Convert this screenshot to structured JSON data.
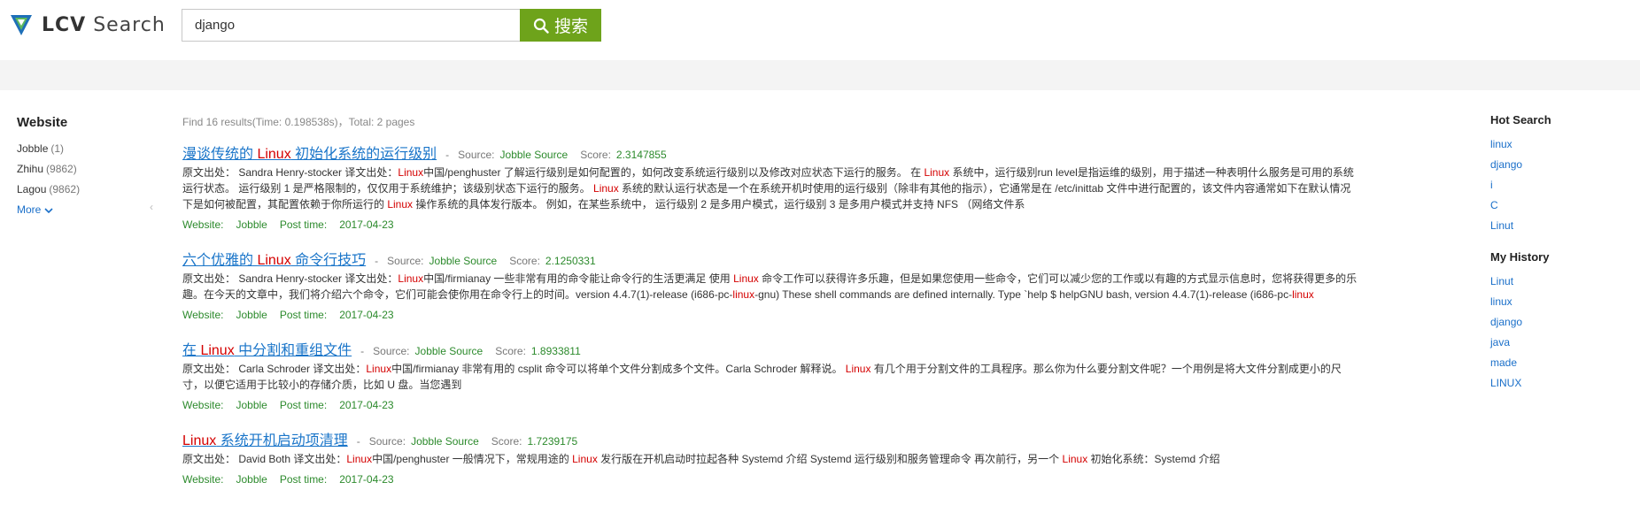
{
  "logo": {
    "brand": "LCV",
    "suffix": "Search"
  },
  "search": {
    "query": "django",
    "button_label": "搜索"
  },
  "left_nav": {
    "title": "Website",
    "items": [
      {
        "label": "Jobble",
        "count": "(1)"
      },
      {
        "label": "Zhihu",
        "count": "(9862)"
      },
      {
        "label": "Lagou",
        "count": "(9862)"
      }
    ],
    "more_label": "More"
  },
  "summary": "Find 16 results(Time: 0.198538s)，Total: 2 pages",
  "labels": {
    "source": "Source:",
    "score": "Score:",
    "website": "Website:",
    "post_time": "Post time:"
  },
  "results": [
    {
      "title_pre": "漫谈传统的 ",
      "title_hl": "Linux",
      "title_post": " 初始化系统的运行级别",
      "source": "Jobble Source",
      "score": "2.3147855",
      "body": [
        {
          "t": "原文出处： Sandra Henry-stocker 译文出处："
        },
        {
          "t": "Linux",
          "hl": true
        },
        {
          "t": "中国/penghuster 了解运行级别是如何配置的，如何改变系统运行级别以及修改对应状态下运行的服务。 在 "
        },
        {
          "t": "Linux",
          "hl": true
        },
        {
          "t": " 系统中，运行级别run level是指运维的级别，用于描述一种表明什么服务是可用的系统运行状态。 运行级别 1 是严格限制的，仅仅用于系统维护；该级别状态下运行的服务。 "
        },
        {
          "t": "Linux",
          "hl": true
        },
        {
          "t": " 系统的默认运行状态是一个在系统开机时使用的运行级别（除非有其他的指示），它通常是在 /etc/inittab 文件中进行配置的，该文件内容通常如下在默认情况下是如何被配置，其配置依赖于你所运行的 "
        },
        {
          "t": "Linux",
          "hl": true
        },
        {
          "t": " 操作系统的具体发行版本。 例如，在某些系统中， 运行级别 2 是多用户模式，运行级别 3 是多用户模式并支持 NFS （网络文件系"
        }
      ],
      "website": "Jobble",
      "post_time": "2017-04-23"
    },
    {
      "title_pre": "六个优雅的 ",
      "title_hl": "Linux",
      "title_post": " 命令行技巧",
      "source": "Jobble Source",
      "score": "2.1250331",
      "body": [
        {
          "t": "原文出处： Sandra Henry-stocker 译文出处："
        },
        {
          "t": "Linux",
          "hl": true
        },
        {
          "t": "中国/firmianay 一些非常有用的命令能让命令行的生活更满足 使用 "
        },
        {
          "t": "Linux",
          "hl": true
        },
        {
          "t": " 命令工作可以获得许多乐趣，但是如果您使用一些命令，它们可以减少您的工作或以有趣的方式显示信息时，您将获得更多的乐趣。在今天的文章中，我们将介绍六个命令，它们可能会使你用在命令行上的时间。version 4.4.7(1)-release (i686-pc-"
        },
        {
          "t": "linux",
          "hl": true
        },
        {
          "t": "-gnu) These shell commands are defined internally. Type `help $ helpGNU bash, version 4.4.7(1)-release (i686-pc-"
        },
        {
          "t": "linux",
          "hl": true
        }
      ],
      "website": "Jobble",
      "post_time": "2017-04-23"
    },
    {
      "title_pre": "在 ",
      "title_hl": "Linux",
      "title_post": " 中分割和重组文件",
      "source": "Jobble Source",
      "score": "1.8933811",
      "body": [
        {
          "t": "原文出处： Carla Schroder 译文出处："
        },
        {
          "t": "Linux",
          "hl": true
        },
        {
          "t": "中国/firmianay 非常有用的 csplit 命令可以将单个文件分割成多个文件。Carla Schroder 解释说。 "
        },
        {
          "t": "Linux",
          "hl": true
        },
        {
          "t": " 有几个用于分割文件的工具程序。那么你为什么要分割文件呢？一个用例是将大文件分割成更小的尺寸，以便它适用于比较小的存储介质，比如 U 盘。当您遇到"
        }
      ],
      "website": "Jobble",
      "post_time": "2017-04-23"
    },
    {
      "title_pre": "",
      "title_hl": "Linux",
      "title_post": " 系统开机启动项清理",
      "source": "Jobble Source",
      "score": "1.7239175",
      "body": [
        {
          "t": "原文出处： David Both 译文出处："
        },
        {
          "t": "Linux",
          "hl": true
        },
        {
          "t": "中国/penghuster 一般情况下，常规用途的 "
        },
        {
          "t": "Linux",
          "hl": true
        },
        {
          "t": " 发行版在开机启动时拉起各种 Systemd 介绍 Systemd 运行级别和服务管理命令 再次前行，另一个 "
        },
        {
          "t": "Linux",
          "hl": true
        },
        {
          "t": " 初始化系统：Systemd 介绍"
        }
      ],
      "website": "Jobble",
      "post_time": "2017-04-23"
    }
  ],
  "right_nav": {
    "hot_title": "Hot Search",
    "hot": [
      "linux",
      "django",
      "i",
      "C",
      "Linut"
    ],
    "history_title": "My History",
    "history": [
      "Linut",
      "linux",
      "django",
      "java",
      "made",
      "LINUX"
    ]
  },
  "colors": {
    "accent_green": "#6ea31b",
    "link_blue": "#1a75c9",
    "highlight_red": "#d40000",
    "meta_green": "#2c8a2c"
  }
}
